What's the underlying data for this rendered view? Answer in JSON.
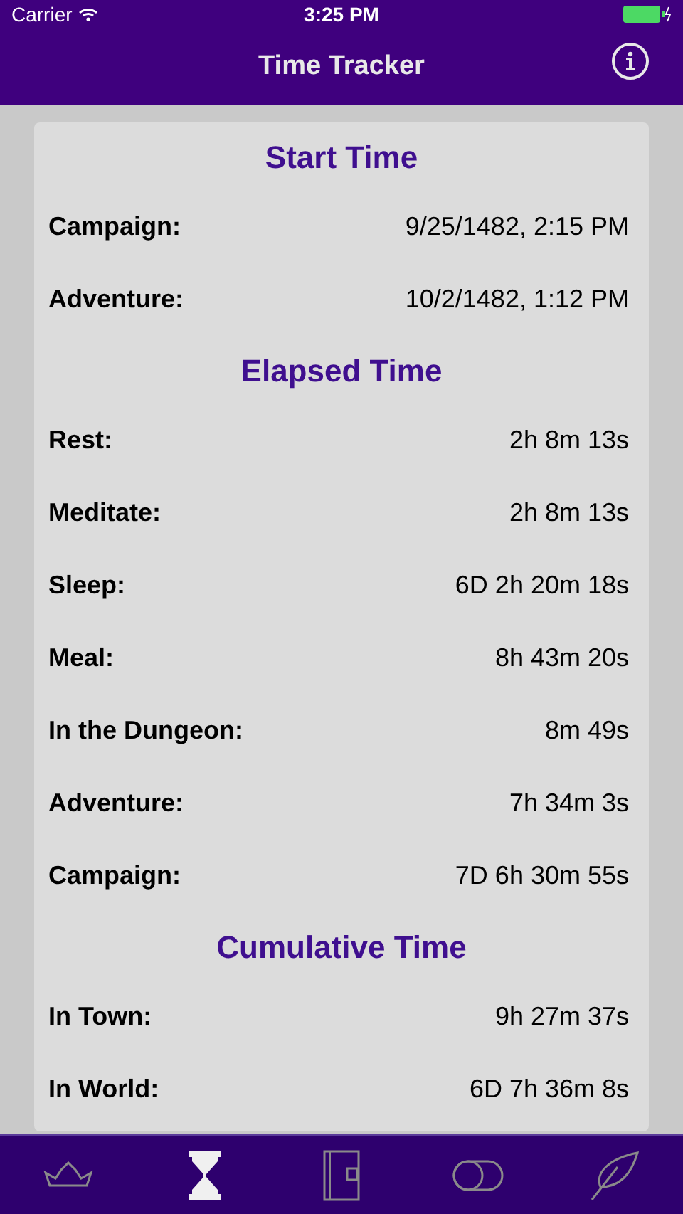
{
  "status_bar": {
    "carrier": "Carrier",
    "time": "3:25 PM"
  },
  "nav": {
    "title": "Time Tracker"
  },
  "sections": [
    {
      "title": "Start Time",
      "rows": [
        {
          "label": "Campaign:",
          "value": "9/25/1482, 2:15 PM"
        },
        {
          "label": "Adventure:",
          "value": "10/2/1482, 1:12 PM"
        }
      ]
    },
    {
      "title": "Elapsed Time",
      "rows": [
        {
          "label": "Rest:",
          "value": "2h 8m 13s"
        },
        {
          "label": "Meditate:",
          "value": "2h 8m 13s"
        },
        {
          "label": "Sleep:",
          "value": "6D 2h 20m 18s"
        },
        {
          "label": "Meal:",
          "value": "8h 43m 20s"
        },
        {
          "label": "In the Dungeon:",
          "value": "8m 49s"
        },
        {
          "label": "Adventure:",
          "value": "7h 34m 3s"
        },
        {
          "label": "Campaign:",
          "value": "7D 6h 30m 55s"
        }
      ]
    },
    {
      "title": "Cumulative Time",
      "rows": [
        {
          "label": "In Town:",
          "value": "9h 27m 37s"
        },
        {
          "label": "In World:",
          "value": "6D 7h 36m 8s"
        }
      ]
    }
  ],
  "tabs": [
    {
      "kind": "crown",
      "selected": false
    },
    {
      "kind": "hourglass",
      "selected": true
    },
    {
      "kind": "book",
      "selected": false
    },
    {
      "kind": "toggle",
      "selected": false
    },
    {
      "kind": "feather",
      "selected": false
    }
  ]
}
